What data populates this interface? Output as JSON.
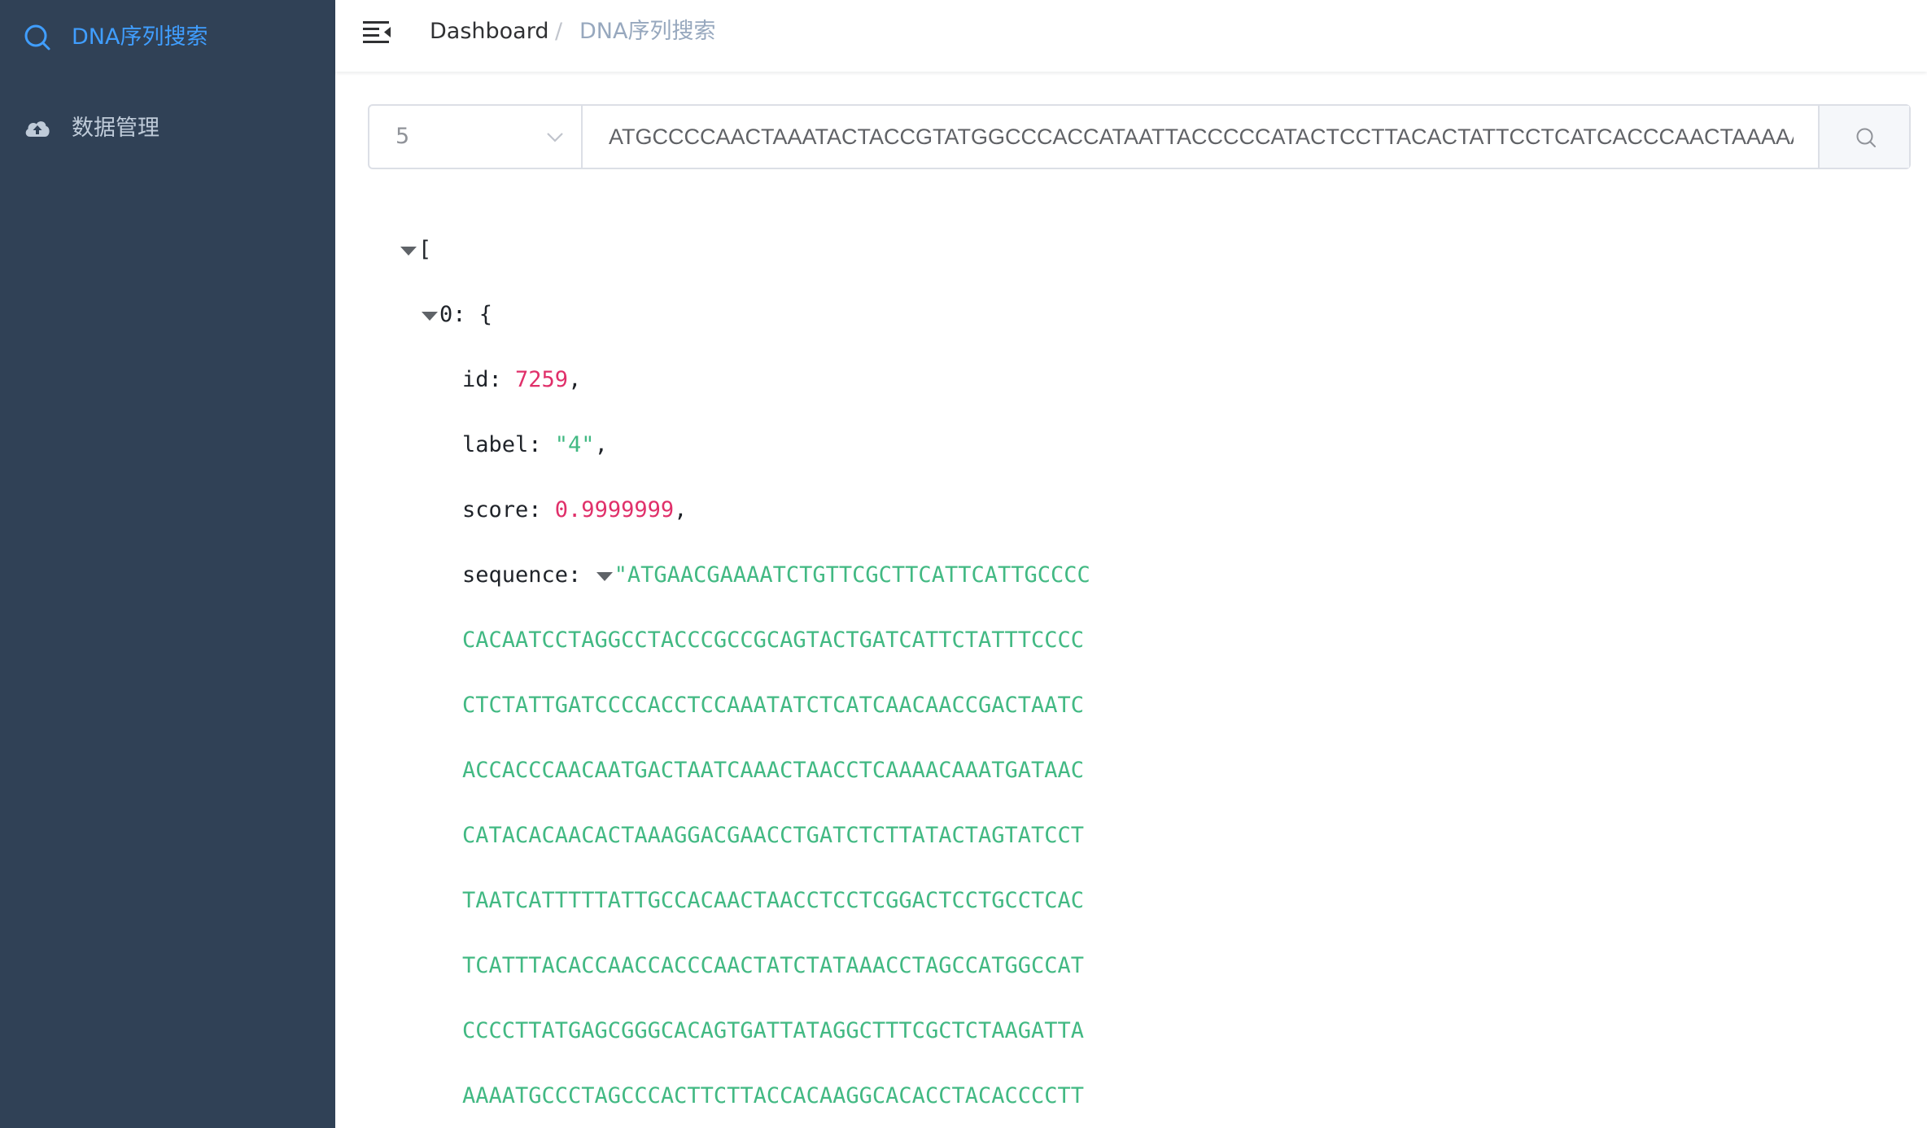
{
  "sidebar": {
    "items": [
      {
        "label": "DNA序列搜索",
        "icon": "search-icon",
        "active": true
      },
      {
        "label": "数据管理",
        "icon": "cloud-upload-icon",
        "active": false
      }
    ],
    "background": "#304156",
    "active_color": "#409eff"
  },
  "header": {
    "menu_icon": "hamburger-icon",
    "breadcrumb": [
      {
        "label": "Dashboard"
      },
      {
        "label": "/"
      },
      {
        "label": "DNA序列搜索"
      }
    ]
  },
  "search": {
    "topk_value": "5",
    "query_value": "ATGCCCCAACTAAATACTACCGTATGGCCCACCATAATTACCCCCATACTCCTTACACTATTCCTCATCACCCAACTAAAAATATTAAACACAAACTACCACCTACCTCCCTCACCAAAGCCCATAAAAATAAAAAATTATAACAAACCCTGAGAACCAAAATGAACGAAAATCTGTTCGCTTCATTCATTGCCCC",
    "button_icon": "search-icon"
  },
  "result": {
    "open_bracket": "[",
    "item_index": "0",
    "item_colon": ":",
    "item_brace": "{",
    "fields": {
      "id_key": "id",
      "id_value": "7259",
      "label_key": "label",
      "label_value": "\"4\"",
      "score_key": "score",
      "score_value": "0.9999999",
      "sequence_key": "sequence"
    },
    "sequence_lines": [
      "\"ATGAACGAAAATCTGTTCGCTTCATTCATTGCCCC",
      "CACAATCCTAGGCCTACCCGCCGCAGTACTGATCATTCTATTTCCCC",
      "CTCTATTGATCCCCACCTCCAAATATCTCATCAACAACCGACTAATC",
      "ACCACCCAACAATGACTAATCAAACTAACCTCAAAACAAATGATAAC",
      "CATACACAACACTAAAGGACGAACCTGATCTCTTATACTAGTATCCT",
      "TAATCATTTTTATTGCCACAACTAACCTCCTCGGACTCCTGCCTCAC",
      "TCATTTACACCAACCACCCAACTATCTATAAACCTAGCCATGGCCAT",
      "CCCCTTATGAGCGGGCACAGTGATTATAGGCTTTCGCTCTAAGATTA",
      "AAAATGCCCTAGCCCACTTCTTACCACAAGGCACACCTACACCCCTT"
    ],
    "colors": {
      "number": "#e0306a",
      "string": "#42b983"
    }
  }
}
